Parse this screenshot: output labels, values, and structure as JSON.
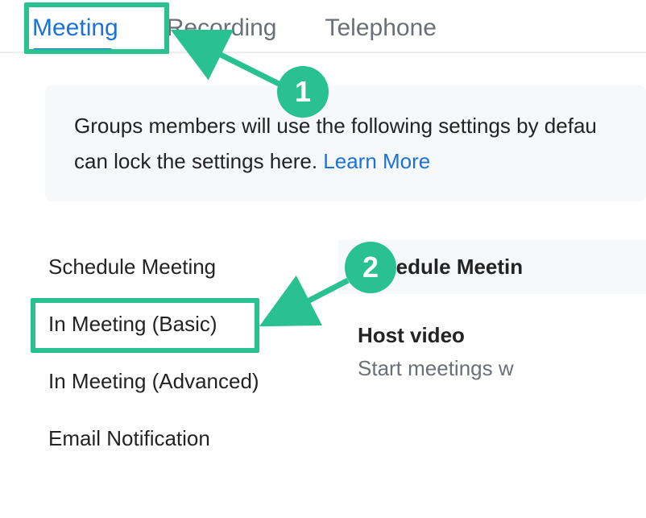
{
  "tabs": {
    "meeting": "Meeting",
    "recording": "Recording",
    "telephone": "Telephone"
  },
  "banner": {
    "text_line1": "Groups members will use the following settings by defau",
    "text_line2_prefix": "can lock the settings here. ",
    "learn_more": "Learn More"
  },
  "nav": {
    "schedule_meeting": "Schedule Meeting",
    "in_meeting_basic": "In Meeting (Basic)",
    "in_meeting_advanced": "In Meeting (Advanced)",
    "email_notification": "Email Notification"
  },
  "content": {
    "section_header": "Schedule Meetin",
    "host_video_title": "Host video",
    "host_video_desc": "Start meetings w"
  },
  "annotations": {
    "badge1": "1",
    "badge2": "2"
  },
  "colors": {
    "accent": "#28c18f",
    "link": "#1a73d8"
  }
}
